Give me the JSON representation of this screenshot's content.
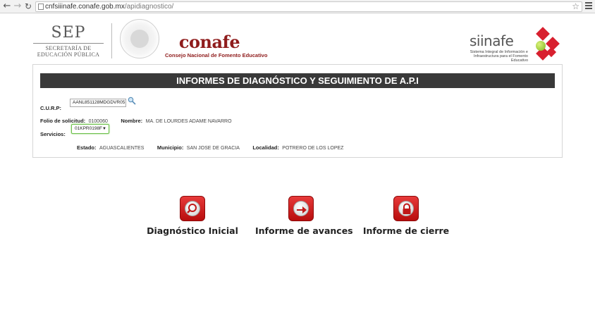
{
  "browser": {
    "url_domain": "cnfsiiinafe.conafe.gob.mx",
    "url_path": "/apidiagnostico/"
  },
  "header": {
    "sep_word": "SEP",
    "sep_sub_1": "SECRETARÍA DE",
    "sep_sub_2": "EDUCACIÓN PÚBLICA",
    "conafe_word": "conafe",
    "conafe_sub": "Consejo Nacional de Fomento Educativo",
    "siinafe_word": "siinafe",
    "siinafe_sub": "Sistema Integral de Información e Infraestructura para el Fomento Educativo"
  },
  "panel": {
    "title": "INFORMES DE DIAGNÓSTICO Y SEGUIMIENTO DE A.P.I",
    "curp_label": "C.U.R.P:",
    "curp_value": "AANL851128MDGDVR05",
    "folio_label": "Folio de solicitud:",
    "folio_value": "0100060",
    "nombre_label": "Nombre:",
    "nombre_value": "MA. DE LOURDES ADAME NAVARRO",
    "servicios_label": "Servicios:",
    "servicios_selected": "01KPR0198F",
    "estado_label": "Estado:",
    "estado_value": "AGUASCALIENTES",
    "municipio_label": "Municipio:",
    "municipio_value": "SAN JOSE DE GRACIA",
    "localidad_label": "Localidad:",
    "localidad_value": "POTRERO DE LOS LOPEZ"
  },
  "actions": [
    {
      "label": "Diagnóstico Inicial",
      "icon": "magnifier-icon"
    },
    {
      "label": "Informe de avances",
      "icon": "arrow-right-icon"
    },
    {
      "label": "Informe de cierre",
      "icon": "padlock-icon"
    }
  ],
  "colors": {
    "accent_red": "#d8202f",
    "title_bar": "#393939",
    "conafe_red": "#8f1c1c"
  }
}
